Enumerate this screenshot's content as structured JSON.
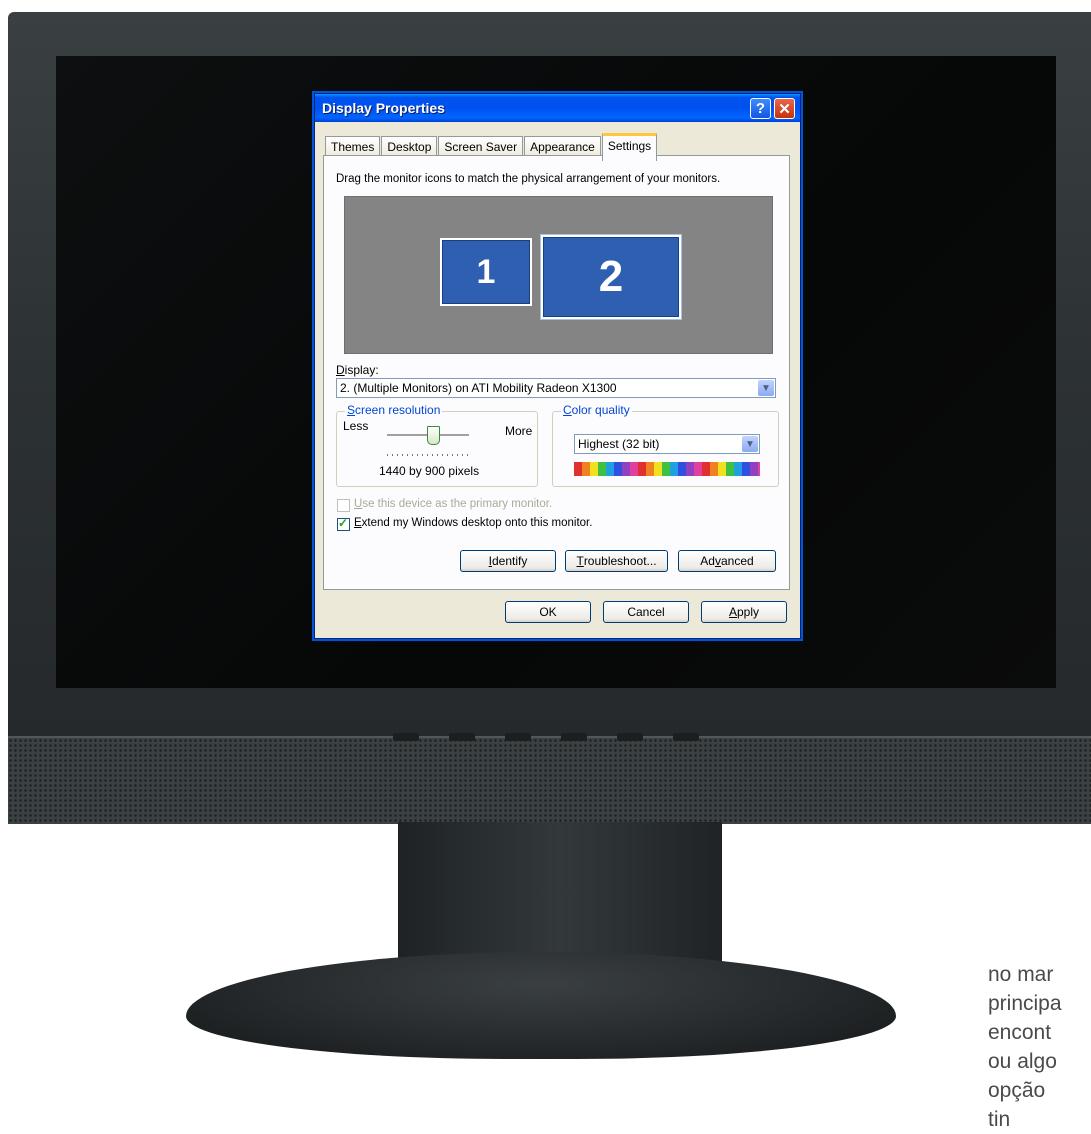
{
  "window": {
    "title": "Display Properties",
    "help_label": "?",
    "close_label": "✕"
  },
  "tabs": [
    {
      "label": "Themes"
    },
    {
      "label": "Desktop"
    },
    {
      "label": "Screen Saver"
    },
    {
      "label": "Appearance"
    },
    {
      "label": "Settings",
      "active": true
    }
  ],
  "settings": {
    "instruction": "Drag the monitor icons to match the physical arrangement of your monitors.",
    "monitors": [
      {
        "label": "1"
      },
      {
        "label": "2",
        "selected": true
      }
    ],
    "display_label_first": "D",
    "display_label_rest": "isplay:",
    "display_value": "2. (Multiple Monitors) on ATI Mobility Radeon X1300",
    "resolution": {
      "label_first": "S",
      "label_rest": "creen resolution",
      "less": "Less",
      "more": "More",
      "value": "1440 by 900 pixels"
    },
    "color_quality": {
      "label_first": "C",
      "label_rest": "olor quality",
      "value": "Highest (32 bit)"
    },
    "primary_checkbox": {
      "label_first": "U",
      "label_rest": "se this device as the primary monitor.",
      "checked": false,
      "enabled": false
    },
    "extend_checkbox": {
      "label_first": "E",
      "label_rest": "xtend my Windows desktop onto this monitor.",
      "checked": true,
      "enabled": true
    },
    "buttons": {
      "identify_first": "I",
      "identify_rest": "dentify",
      "troubleshoot_first": "T",
      "troubleshoot_rest": "roubleshoot...",
      "advanced_pre": "Ad",
      "advanced_u": "v",
      "advanced_post": "anced"
    }
  },
  "footer": {
    "ok": "OK",
    "cancel": "Cancel",
    "apply_first": "A",
    "apply_rest": "pply"
  },
  "page_text_lines": [
    "no mar",
    "principa",
    "encont",
    "ou algo",
    "opção",
    "tin"
  ],
  "colors": {
    "titlebar": "#0053ee",
    "dialog_bg": "#ece9d8",
    "monitor_icon": "#2f5fb0",
    "bezel": "#2c3133"
  }
}
